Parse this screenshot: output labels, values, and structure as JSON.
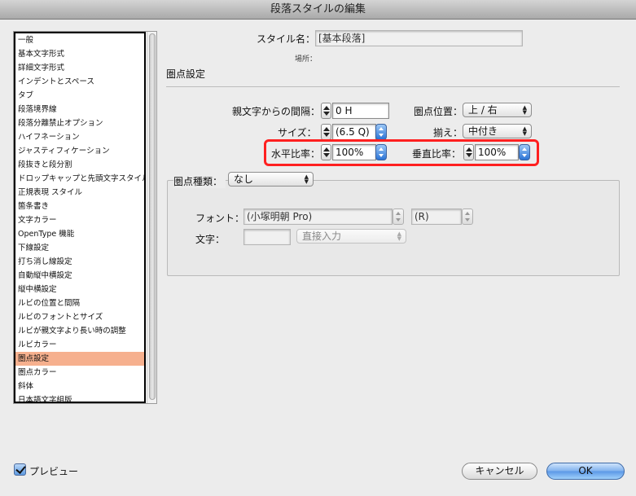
{
  "window": {
    "title": "段落スタイルの編集"
  },
  "sidebar": {
    "items": [
      "一般",
      "基本文字形式",
      "詳細文字形式",
      "インデントとスペース",
      "タブ",
      "段落境界線",
      "段落分離禁止オプション",
      "ハイフネーション",
      "ジャスティフィケーション",
      "段抜きと段分割",
      "ドロップキャップと先頭文字スタイル",
      "正規表現 スタイル",
      "箇条書き",
      "文字カラー",
      "OpenType 機能",
      "下線設定",
      "打ち消し線設定",
      "自動縦中横設定",
      "縦中横設定",
      "ルビの位置と間隔",
      "ルビのフォントとサイズ",
      "ルビが親文字より長い時の調整",
      "ルビカラー",
      "圏点設定",
      "圏点カラー",
      "斜体",
      "日本語文字組版"
    ],
    "selected_index": 23
  },
  "header": {
    "style_name_label": "スタイル名：",
    "style_name_value": "[基本段落]",
    "location_label": "場所：",
    "section_title": "圏点設定"
  },
  "settings": {
    "spacing_label": "親文字からの間隔：",
    "spacing_value": "0 H",
    "position_label": "圏点位置：",
    "position_value": "上 / 右",
    "size_label": "サイズ：",
    "size_value": "(6.5 Q)",
    "alignment_label": "揃え：",
    "alignment_value": "中付き",
    "h_scale_label": "水平比率：",
    "h_scale_value": "100%",
    "v_scale_label": "垂直比率：",
    "v_scale_value": "100%"
  },
  "kenten": {
    "type_label": "圏点種類：",
    "type_value": "なし",
    "font_label": "フォント：",
    "font_value": "(小塚明朝 Pro)",
    "font_style_value": "(R)",
    "char_label": "文字：",
    "char_value": "",
    "input_mode_value": "直接入力"
  },
  "footer": {
    "preview_label": "プレビュー",
    "preview_checked": true,
    "cancel_label": "キャンセル",
    "ok_label": "OK"
  }
}
